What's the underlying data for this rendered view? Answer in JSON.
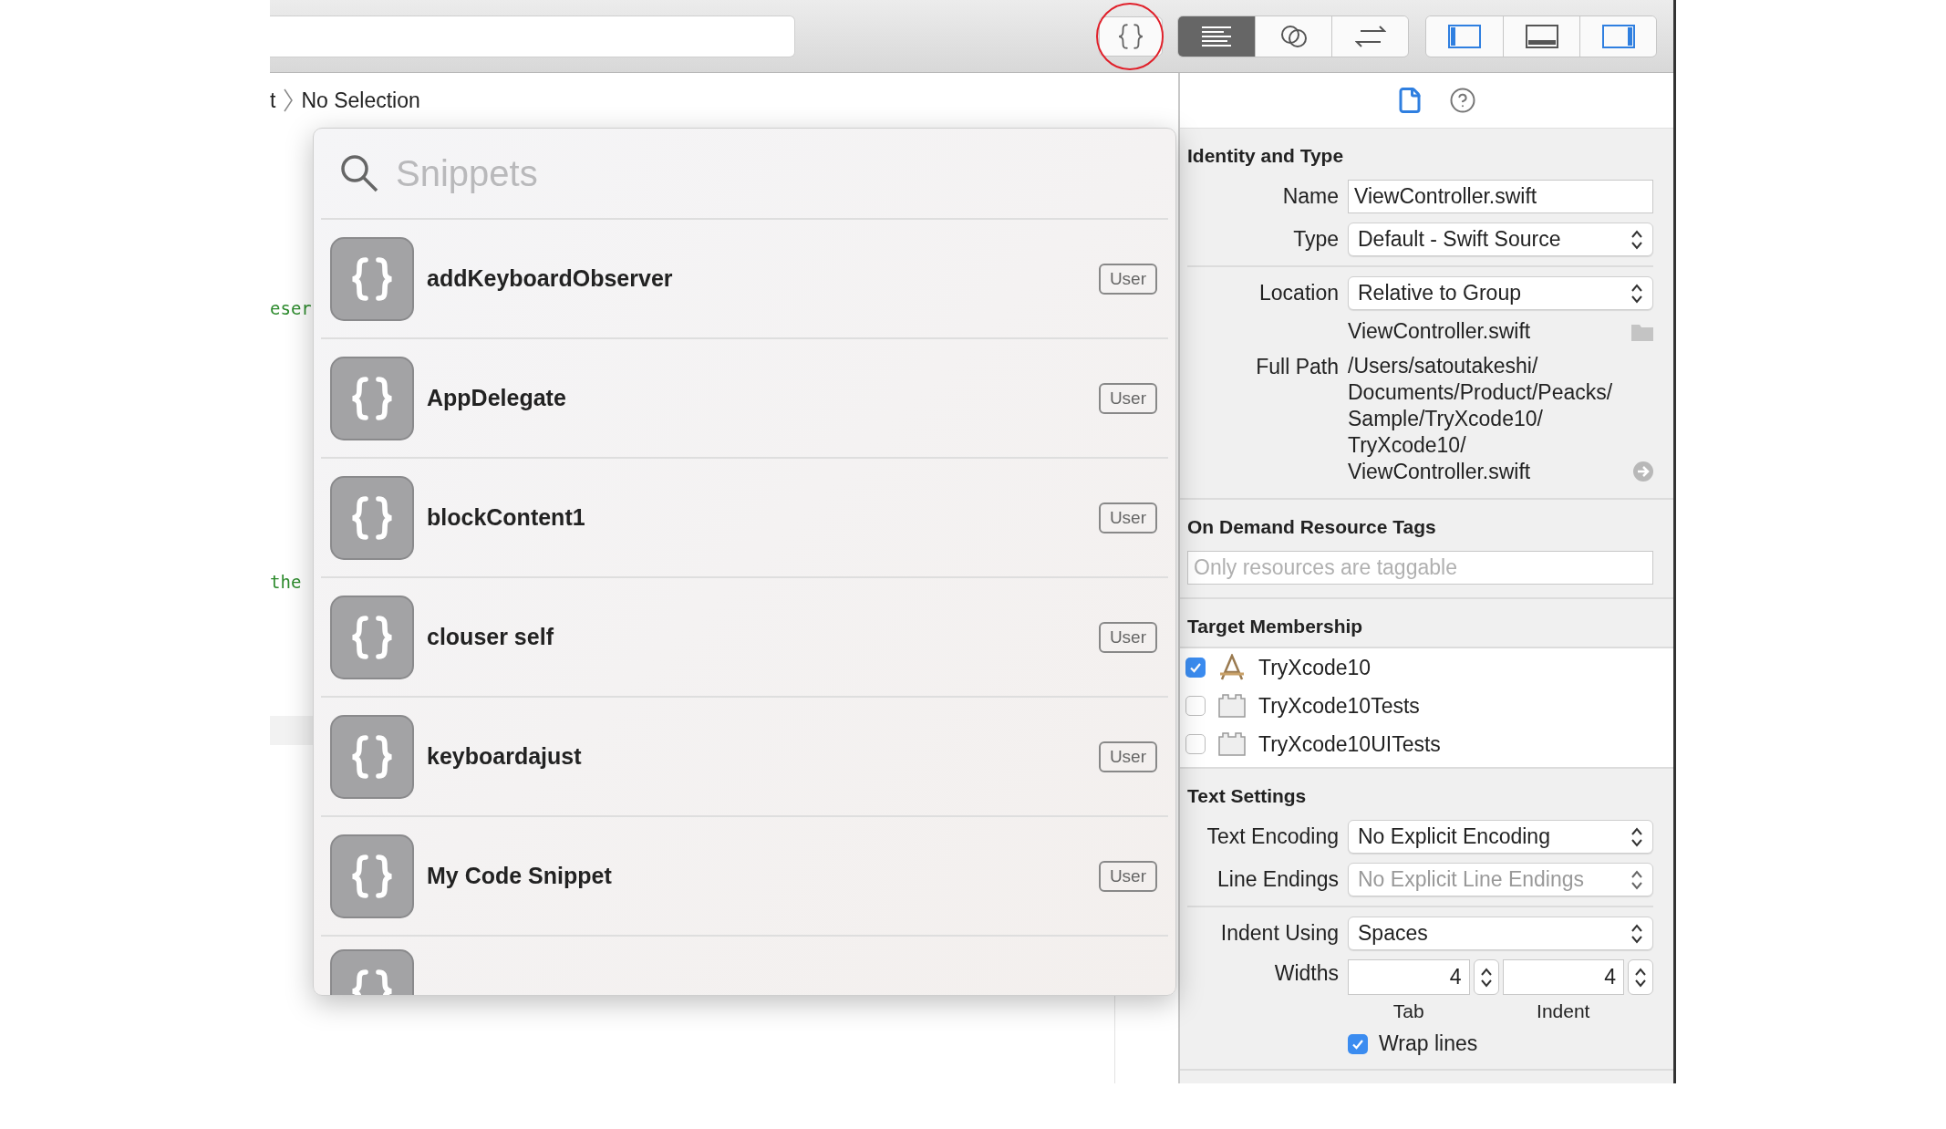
{
  "toolbar": {
    "snippet_button": {
      "circled": true
    },
    "editor_modes": [
      {
        "kind": "standard",
        "selected": true
      },
      {
        "kind": "assistant",
        "selected": false
      },
      {
        "kind": "version",
        "selected": false
      }
    ],
    "panels": [
      {
        "kind": "navigator",
        "on": true
      },
      {
        "kind": "debug",
        "on": false
      },
      {
        "kind": "utilities",
        "on": true
      }
    ]
  },
  "jump_bar": {
    "crumb": "t",
    "current": "No Selection"
  },
  "code": [
    {
      "text": "eser"
    },
    {
      "text": "the"
    }
  ],
  "snippet_library": {
    "search_placeholder": "Snippets",
    "items": [
      {
        "name": "addKeyboardObserver",
        "badge": "User"
      },
      {
        "name": "AppDelegate",
        "badge": "User"
      },
      {
        "name": "blockContent1",
        "badge": "User"
      },
      {
        "name": "clouser self",
        "badge": "User"
      },
      {
        "name": "keyboardajust",
        "badge": "User"
      },
      {
        "name": "My Code Snippet",
        "badge": "User"
      }
    ],
    "more_below": true
  },
  "inspector": {
    "tabs": [
      {
        "kind": "file",
        "selected": true
      },
      {
        "kind": "help",
        "selected": false
      }
    ],
    "identity": {
      "title": "Identity and Type",
      "name_label": "Name",
      "name_value": "ViewController.swift",
      "type_label": "Type",
      "type_value": "Default - Swift Source",
      "location_label": "Location",
      "location_value": "Relative to Group",
      "file_name": "ViewController.swift",
      "full_path_label": "Full Path",
      "full_path_lines": [
        "/Users/satoutakeshi/",
        "Documents/Product/Peacks/",
        "Sample/TryXcode10/",
        "TryXcode10/",
        "ViewController.swift"
      ]
    },
    "resource_tags": {
      "title": "On Demand Resource Tags",
      "placeholder": "Only resources are taggable"
    },
    "target_membership": {
      "title": "Target Membership",
      "targets": [
        {
          "name": "TryXcode10",
          "kind": "app",
          "checked": true
        },
        {
          "name": "TryXcode10Tests",
          "kind": "bundle",
          "checked": false
        },
        {
          "name": "TryXcode10UITests",
          "kind": "bundle",
          "checked": false
        }
      ]
    },
    "text_settings": {
      "title": "Text Settings",
      "encoding_label": "Text Encoding",
      "encoding_value": "No Explicit Encoding",
      "line_endings_label": "Line Endings",
      "line_endings_value": "No Explicit Line Endings",
      "line_endings_disabled": true,
      "indent_label": "Indent Using",
      "indent_value": "Spaces",
      "widths_label": "Widths",
      "tab_value": "4",
      "tab_caption": "Tab",
      "indent_width_value": "4",
      "indent_caption": "Indent",
      "wrap_label": "Wrap lines",
      "wrap_checked": true
    }
  }
}
